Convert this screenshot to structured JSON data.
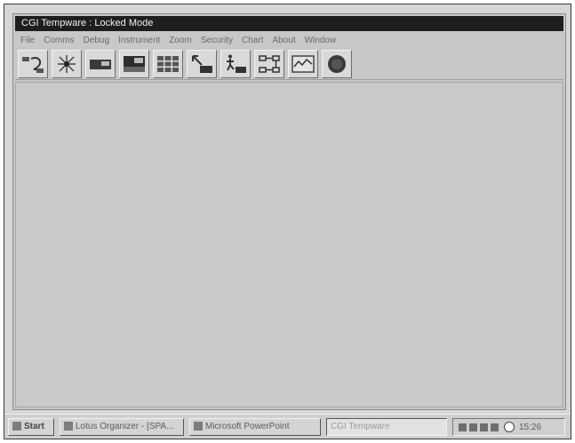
{
  "window": {
    "title": "CGI Tempware : Locked Mode"
  },
  "menu": {
    "items": [
      "File",
      "Comms",
      "Debug",
      "Instrument",
      "Zoom",
      "Security",
      "Chart",
      "About",
      "Window"
    ]
  },
  "toolbar": {
    "buttons": [
      "connection-icon",
      "spark-icon",
      "instrument-panel-icon",
      "instrument-display-icon",
      "grid-icon",
      "sensor-arrow-icon",
      "sensor-walk-icon",
      "network-icon",
      "chart-trend-icon",
      "stop-icon"
    ]
  },
  "taskbar": {
    "start_label": "Start",
    "tasks": [
      {
        "label": "Lotus Organizer - [SPA..."
      },
      {
        "label": "Microsoft PowerPoint"
      },
      {
        "label": "CGI Tempware"
      }
    ],
    "clock": "15:26"
  }
}
